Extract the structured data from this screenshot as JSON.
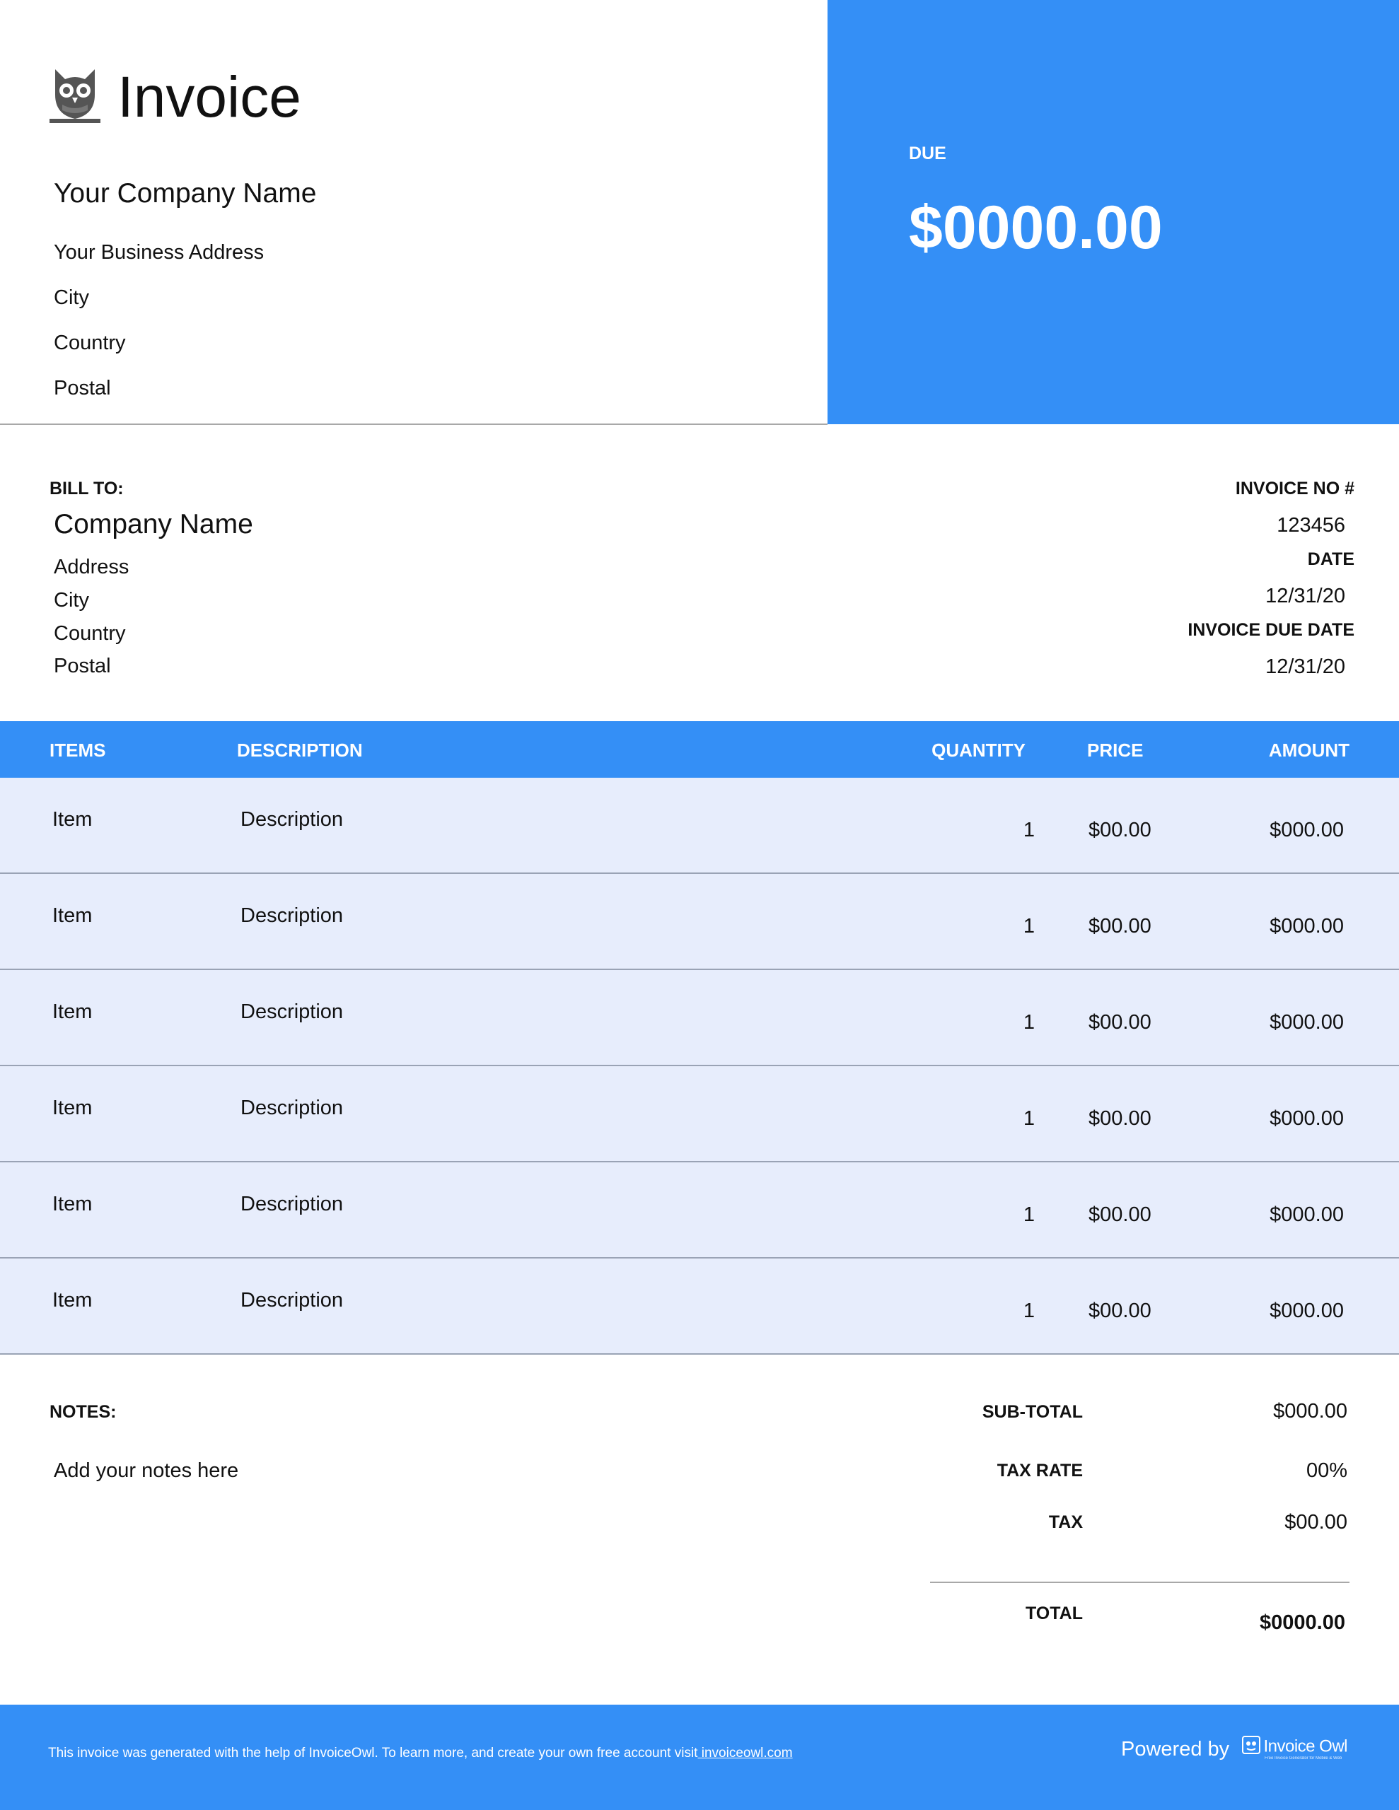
{
  "header": {
    "title": "Invoice",
    "company_name": "Your Company Name",
    "address_lines": [
      "Your Business Address",
      "City",
      "Country",
      "Postal"
    ],
    "due_label": "DUE",
    "due_amount": "$0000.00",
    "accent_color": "#348ff6"
  },
  "bill_to": {
    "label": "BILL TO:",
    "company_name": "Company Name",
    "lines": [
      "Address",
      "City",
      "Country",
      "Postal"
    ]
  },
  "invoice_meta": {
    "number_label": "INVOICE NO #",
    "number": "123456",
    "date_label": "DATE",
    "date": "12/31/20",
    "due_date_label": "INVOICE DUE DATE",
    "due_date": "12/31/20"
  },
  "items_table": {
    "columns": [
      "ITEMS",
      "DESCRIPTION",
      "QUANTITY",
      "PRICE",
      "AMOUNT"
    ],
    "rows": [
      {
        "item": "Item",
        "description": "Description",
        "quantity": "1",
        "price": "$00.00",
        "amount": "$000.00"
      },
      {
        "item": "Item",
        "description": "Description",
        "quantity": "1",
        "price": "$00.00",
        "amount": "$000.00"
      },
      {
        "item": "Item",
        "description": "Description",
        "quantity": "1",
        "price": "$00.00",
        "amount": "$000.00"
      },
      {
        "item": "Item",
        "description": "Description",
        "quantity": "1",
        "price": "$00.00",
        "amount": "$000.00"
      },
      {
        "item": "Item",
        "description": "Description",
        "quantity": "1",
        "price": "$00.00",
        "amount": "$000.00"
      },
      {
        "item": "Item",
        "description": "Description",
        "quantity": "1",
        "price": "$00.00",
        "amount": "$000.00"
      }
    ],
    "row_background": "#e7edfc"
  },
  "notes": {
    "label": "NOTES:",
    "text": "Add your notes here"
  },
  "totals": {
    "subtotal_label": "SUB-TOTAL",
    "subtotal": "$000.00",
    "tax_rate_label": "TAX RATE",
    "tax_rate": "00%",
    "tax_label": "TAX",
    "tax": "$00.00",
    "total_label": "TOTAL",
    "total": "$0000.00"
  },
  "footer": {
    "note": "This invoice was generated with the help of InvoiceOwl. To learn more, and create your own free account visit",
    "link_text": " invoiceowl.com",
    "powered_by": "Powered by",
    "brand_name": "Invoice Owl",
    "brand_tagline": "Free Invoice Generator for Mobile & Web",
    "logo_icon": "owl-icon"
  }
}
